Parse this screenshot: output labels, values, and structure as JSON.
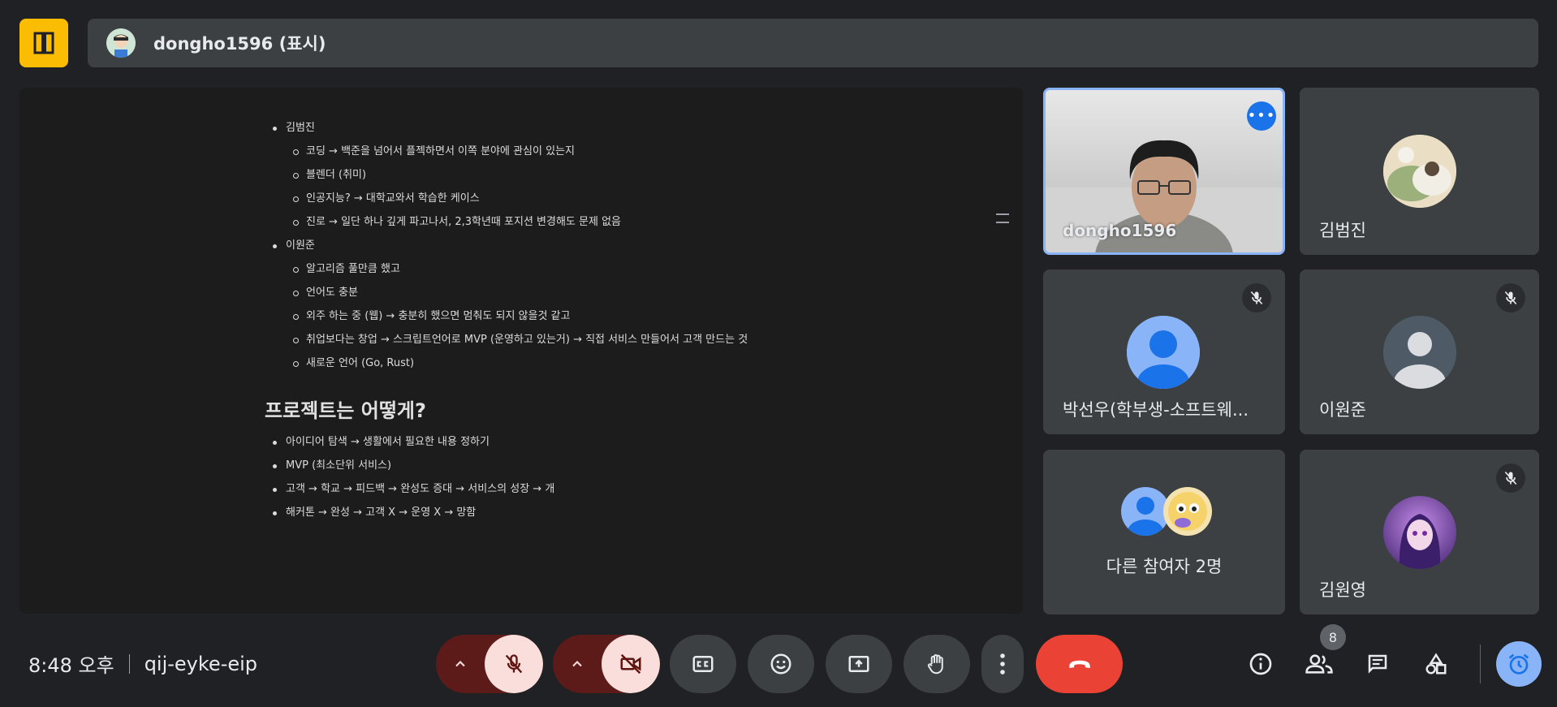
{
  "header": {
    "title": "dongho1596 (표시)"
  },
  "document": {
    "sections": [
      {
        "name": "김범진",
        "items": [
          "코딩 → 백준을 넘어서 플젝하면서 이쪽 분야에 관심이 있는지",
          "블렌더 (취미)",
          "인공지능? → 대학교와서 학습한 케이스",
          "진로 → 일단 하나 깊게 파고나서, 2,3학년때 포지션 변경해도 문제 없음"
        ]
      },
      {
        "name": "이원준",
        "items": [
          "알고리즘 풀만큼 했고",
          "언어도 충분",
          "외주 하는 중 (웹) → 충분히 했으면 멈춰도 되지 않을것 같고",
          "취업보다는 창업 → 스크립트언어로 MVP (운영하고 있는거) → 직접 서비스 만들어서 고객 만드는 것",
          "새로운 언어 (Go, Rust)"
        ]
      }
    ],
    "heading": "프로젝트는 어떻게?",
    "project_items": [
      "아이디어 탐색 → 생활에서 필요한 내용 정하기",
      "MVP (최소단위 서비스)",
      "고객 → 학교 → 피드백 → 완성도 증대 → 서비스의 성장 → 개",
      "해커톤 → 완성 → 고객 X → 운영 X → 망함"
    ]
  },
  "participants": {
    "self_name": "dongho1596",
    "p1": "김범진",
    "p2": "박선우(학부생-소프트웨...",
    "p3": "이원준",
    "others": "다른 참여자 2명",
    "p4": "김원영"
  },
  "footer": {
    "time": "8:48 오후",
    "meeting_code": "qij-eyke-eip",
    "people_count": "8"
  },
  "colors": {
    "accent_blue": "#8ab4f8",
    "end_call_red": "#ea4335",
    "logo_yellow": "#fbbc04"
  }
}
